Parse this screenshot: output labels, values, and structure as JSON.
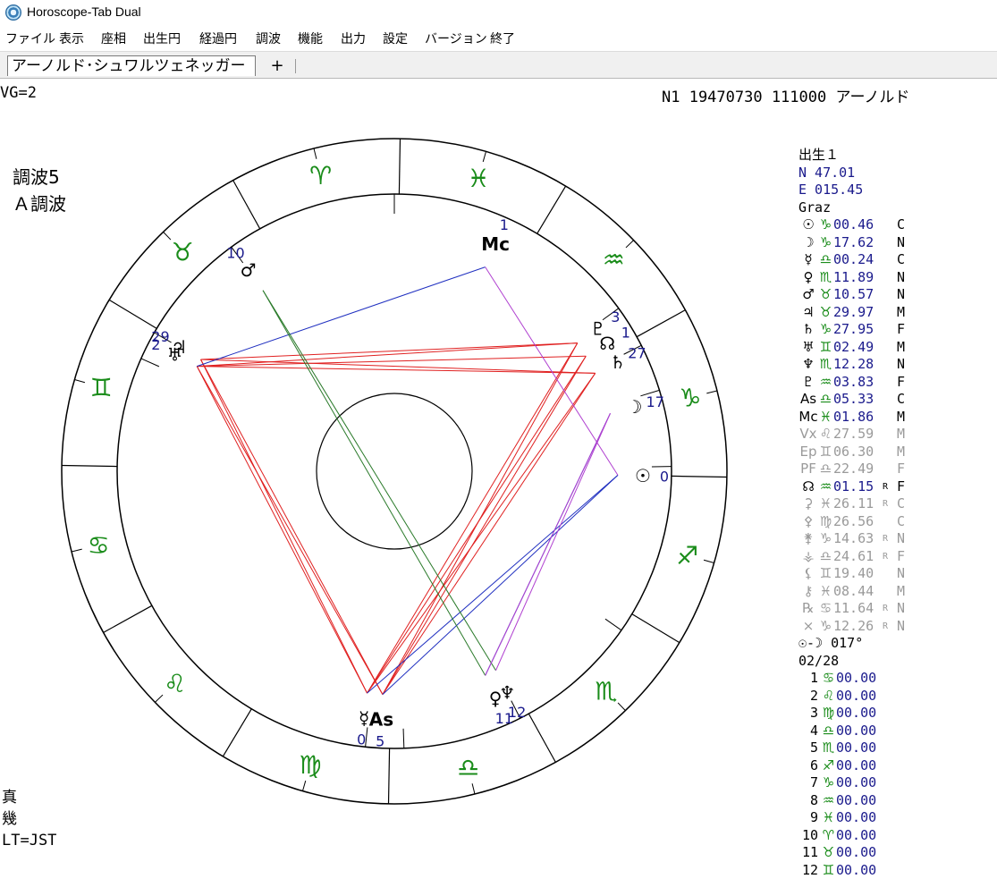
{
  "window": {
    "title": "Horoscope-Tab Dual"
  },
  "menu": [
    "ファイル",
    "表示",
    "座相",
    "出生円",
    "経過円",
    "調波",
    "機能",
    "出力",
    "設定",
    "バージョン",
    "終了"
  ],
  "tabs": {
    "active": "アーノルド･シュワルツェネッガー",
    "add": "+"
  },
  "status": {
    "left": "VG=2",
    "right": "N1  19470730  111000  アーノルド"
  },
  "chart_mode": {
    "line1": "調波5",
    "line2": "Ａ調波"
  },
  "footer": {
    "line1": "真",
    "line2": "幾",
    "line3": "LT=JST"
  },
  "side": {
    "header": "出生１",
    "lat": "N  47.01",
    "lon": "E 015.45",
    "city": "Graz",
    "planets": [
      {
        "glyph": "☉",
        "sign": "♑",
        "value": "00.46",
        "retro": "",
        "code": "C",
        "gray": false
      },
      {
        "glyph": "☽",
        "sign": "♑",
        "value": "17.62",
        "retro": "",
        "code": "N",
        "gray": false
      },
      {
        "glyph": "☿",
        "sign": "♎",
        "value": "00.24",
        "retro": "",
        "code": "C",
        "gray": false
      },
      {
        "glyph": "♀",
        "sign": "♏",
        "value": "11.89",
        "retro": "",
        "code": "N",
        "gray": false
      },
      {
        "glyph": "♂",
        "sign": "♉",
        "value": "10.57",
        "retro": "",
        "code": "N",
        "gray": false
      },
      {
        "glyph": "♃",
        "sign": "♉",
        "value": "29.97",
        "retro": "",
        "code": "M",
        "gray": false
      },
      {
        "glyph": "♄",
        "sign": "♑",
        "value": "27.95",
        "retro": "",
        "code": "F",
        "gray": false
      },
      {
        "glyph": "♅",
        "sign": "♊",
        "value": "02.49",
        "retro": "",
        "code": "M",
        "gray": false
      },
      {
        "glyph": "♆",
        "sign": "♏",
        "value": "12.28",
        "retro": "",
        "code": "N",
        "gray": false
      },
      {
        "glyph": "♇",
        "sign": "♒",
        "value": "03.83",
        "retro": "",
        "code": "F",
        "gray": false
      },
      {
        "glyph": "As",
        "sign": "♎",
        "value": "05.33",
        "retro": "",
        "code": "C",
        "gray": false
      },
      {
        "glyph": "Mc",
        "sign": "♓",
        "value": "01.86",
        "retro": "",
        "code": "M",
        "gray": false
      },
      {
        "glyph": "Vx",
        "sign": "♌",
        "value": "27.59",
        "retro": "",
        "code": "M",
        "gray": true
      },
      {
        "glyph": "Ep",
        "sign": "♊",
        "value": "06.30",
        "retro": "",
        "code": "M",
        "gray": true
      },
      {
        "glyph": "PF",
        "sign": "♎",
        "value": "22.49",
        "retro": "",
        "code": "F",
        "gray": true
      },
      {
        "glyph": "☊",
        "sign": "♒",
        "value": "01.15",
        "retro": "R",
        "code": "F",
        "gray": false
      },
      {
        "glyph": "⚳",
        "sign": "♓",
        "value": "26.11",
        "retro": "R",
        "code": "C",
        "gray": true
      },
      {
        "glyph": "⚴",
        "sign": "♍",
        "value": "26.56",
        "retro": "",
        "code": "C",
        "gray": true
      },
      {
        "glyph": "⚵",
        "sign": "♑",
        "value": "14.63",
        "retro": "R",
        "code": "N",
        "gray": true
      },
      {
        "glyph": "⚶",
        "sign": "♎",
        "value": "24.61",
        "retro": "R",
        "code": "F",
        "gray": true
      },
      {
        "glyph": "⚸",
        "sign": "♊",
        "value": "19.40",
        "retro": "",
        "code": "N",
        "gray": true
      },
      {
        "glyph": "⚷",
        "sign": "♓",
        "value": "08.44",
        "retro": "",
        "code": "M",
        "gray": true
      },
      {
        "glyph": "℞",
        "sign": "♋",
        "value": "11.64",
        "retro": "R",
        "code": "N",
        "gray": true
      },
      {
        "glyph": "×",
        "sign": "♑",
        "value": "12.26",
        "retro": "R",
        "code": "N",
        "gray": true
      }
    ],
    "sun_moon": "☉-☽ 017°",
    "house_system": "02/28",
    "houses": [
      {
        "n": "1",
        "sign": "♋",
        "value": "00.00"
      },
      {
        "n": "2",
        "sign": "♌",
        "value": "00.00"
      },
      {
        "n": "3",
        "sign": "♍",
        "value": "00.00"
      },
      {
        "n": "4",
        "sign": "♎",
        "value": "00.00"
      },
      {
        "n": "5",
        "sign": "♏",
        "value": "00.00"
      },
      {
        "n": "6",
        "sign": "♐",
        "value": "00.00"
      },
      {
        "n": "7",
        "sign": "♑",
        "value": "00.00"
      },
      {
        "n": "8",
        "sign": "♒",
        "value": "00.00"
      },
      {
        "n": "9",
        "sign": "♓",
        "value": "00.00"
      },
      {
        "n": "10",
        "sign": "♈",
        "value": "00.00"
      },
      {
        "n": "11",
        "sign": "♉",
        "value": "00.00"
      },
      {
        "n": "12",
        "sign": "♊",
        "value": "00.00"
      }
    ]
  },
  "wheel": {
    "zodiac": [
      {
        "glyph": "♈",
        "angle": 104
      },
      {
        "glyph": "♓",
        "angle": 74
      },
      {
        "glyph": "♒",
        "angle": 44
      },
      {
        "glyph": "♑",
        "angle": 14
      },
      {
        "glyph": "♐",
        "angle": -16
      },
      {
        "glyph": "♏",
        "angle": -46
      },
      {
        "glyph": "♎",
        "angle": -76
      },
      {
        "glyph": "♍",
        "angle": -106
      },
      {
        "glyph": "♌",
        "angle": -136
      },
      {
        "glyph": "♋",
        "angle": -166
      },
      {
        "glyph": "♊",
        "angle": 164
      },
      {
        "glyph": "♉",
        "angle": 134
      }
    ],
    "planets": [
      {
        "glyph": "Mc",
        "label": "1",
        "angle": 66
      },
      {
        "glyph": "♂",
        "label": "10",
        "angle": 126
      },
      {
        "glyph": "♃",
        "label": "29",
        "angle": 150
      },
      {
        "glyph": "♅",
        "label": "2",
        "angle": 152
      },
      {
        "glyph": "♇",
        "label": "3",
        "angle": 35
      },
      {
        "glyph": "☊",
        "label": "1",
        "angle": 31
      },
      {
        "glyph": "♄",
        "label": "27",
        "angle": 26
      },
      {
        "glyph": "☽",
        "label": "17",
        "angle": 15
      },
      {
        "glyph": "☉",
        "label": "0",
        "angle": -1
      },
      {
        "glyph": "♆",
        "label": "12",
        "angle": -63
      },
      {
        "glyph": "♀",
        "label": "11",
        "angle": -66
      },
      {
        "glyph": "☿",
        "label": "0",
        "angle": -97
      },
      {
        "glyph": "As",
        "label": "5",
        "angle": -93
      }
    ]
  },
  "colors": {
    "zodiac": "#1a8c1a",
    "labels": "#1a1a8c",
    "aspect_red": "#e02020",
    "aspect_blue": "#2030c0",
    "aspect_green": "#2a7a2a",
    "aspect_purple": "#b040d0"
  }
}
